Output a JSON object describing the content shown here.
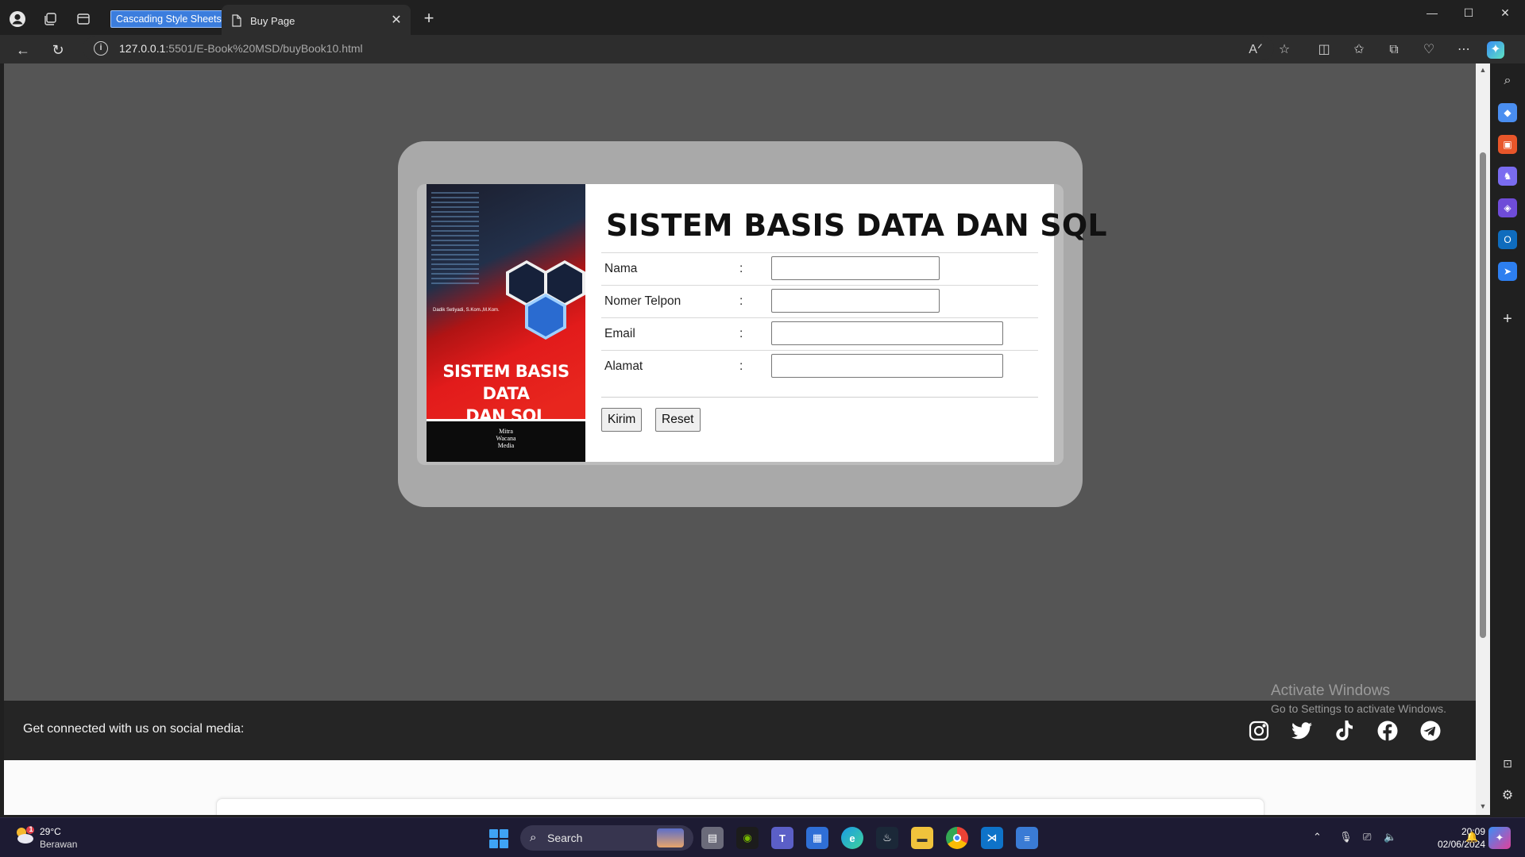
{
  "browser": {
    "selected_tab_label": "Cascading Style Sheets",
    "active_tab_title": "Buy Page",
    "url_host": "127.0.0.1",
    "url_rest": ":5501/E-Book%20MSD/buyBook10.html"
  },
  "book_cover": {
    "author": "Dadik Setiyadi, S.Kom.,M.Kom.",
    "title_line1": "SISTEM BASIS DATA",
    "title_line2": "DAN SQL",
    "publisher_line1": "Mitra",
    "publisher_line2": "Wacana",
    "publisher_line3": "Media"
  },
  "form": {
    "title": "SISTEM BASIS DATA DAN SQL",
    "fields": [
      {
        "label": "Nama",
        "colon": ":",
        "value": ""
      },
      {
        "label": "Nomer Telpon",
        "colon": ":",
        "value": ""
      },
      {
        "label": "Email",
        "colon": ":",
        "value": ""
      },
      {
        "label": "Alamat",
        "colon": ":",
        "value": ""
      }
    ],
    "submit_label": "Kirim",
    "reset_label": "Reset"
  },
  "footer": {
    "text": "Get connected with us on social media:",
    "social_icons": [
      "instagram-icon",
      "twitter-icon",
      "tiktok-icon",
      "facebook-icon",
      "telegram-icon"
    ]
  },
  "watermark": {
    "line1": "Activate Windows",
    "line2": "Go to Settings to activate Windows."
  },
  "taskbar": {
    "weather_badge": "1",
    "temperature": "29°C",
    "condition": "Berawan",
    "search_label": "Search",
    "time": "20:09",
    "date": "02/06/2024"
  },
  "colors": {
    "page_bg": "#555555",
    "outer_card": "#a9a9a9",
    "footer_bg": "#252525",
    "cover_red": "#e21b1b",
    "tab_selection": "#3b7ddd"
  }
}
